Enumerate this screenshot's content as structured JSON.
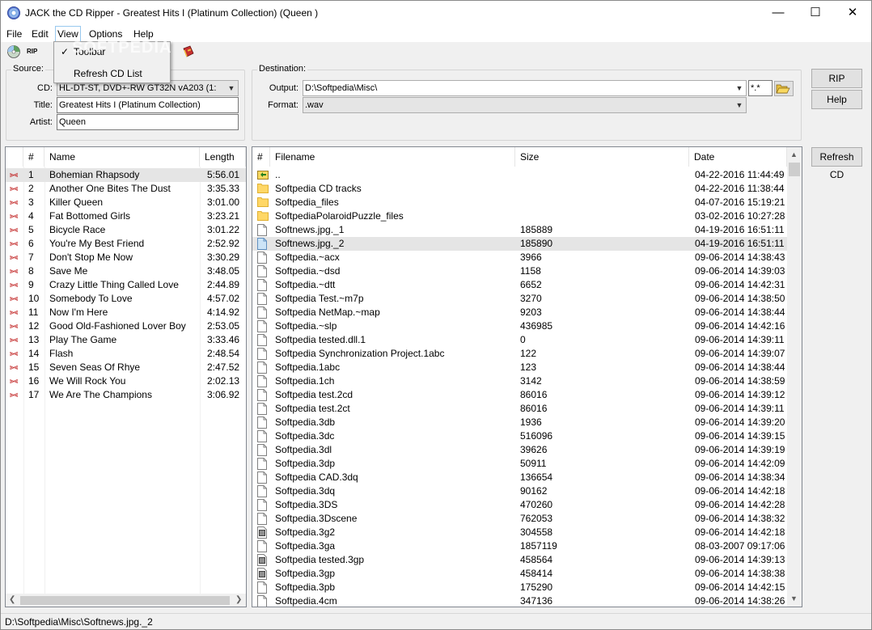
{
  "window": {
    "title": "JACK the CD Ripper - Greatest Hits I (Platinum  Collection) (Queen )",
    "controls": {
      "minimize": "—",
      "maximize": "☐",
      "close": "✕"
    }
  },
  "menu": [
    "File",
    "Edit",
    "View",
    "Options",
    "Help"
  ],
  "view_menu": {
    "items": [
      {
        "label": "Toolbar",
        "checked": true
      },
      {
        "label": "Refresh CD List",
        "checked": false
      }
    ]
  },
  "toolbar": {
    "rip_label": "RIP",
    "icons": [
      "cd-icon",
      "rip-icon",
      "book-icon"
    ]
  },
  "source": {
    "group_label": "Source:",
    "cd_label": "CD:",
    "cd_value": "HL-DT-ST, DVD+-RW GT32N    vA203 (1:",
    "title_label": "Title:",
    "title_value": "Greatest Hits I (Platinum  Collection)",
    "artist_label": "Artist:",
    "artist_value": "Queen"
  },
  "destination": {
    "group_label": "Destination:",
    "output_label": "Output:",
    "output_value": "D:\\Softpedia\\Misc\\",
    "mask_value": "*.*",
    "format_label": "Format:",
    "format_value": ".wav"
  },
  "buttons": {
    "rip": "RIP",
    "help": "Help",
    "refresh_cd": "Refresh CD"
  },
  "tracks": {
    "headers": [
      "#",
      "Name",
      "Length"
    ],
    "rows": [
      {
        "num": "1",
        "name": "Bohemian Rhapsody",
        "length": "5:56.01"
      },
      {
        "num": "2",
        "name": "Another One Bites The Dust",
        "length": "3:35.33"
      },
      {
        "num": "3",
        "name": "Killer Queen",
        "length": "3:01.00"
      },
      {
        "num": "4",
        "name": "Fat Bottomed Girls",
        "length": "3:23.21"
      },
      {
        "num": "5",
        "name": "Bicycle Race",
        "length": "3:01.22"
      },
      {
        "num": "6",
        "name": "You're My Best Friend",
        "length": "2:52.92"
      },
      {
        "num": "7",
        "name": "Don't Stop Me Now",
        "length": "3:30.29"
      },
      {
        "num": "8",
        "name": "Save Me",
        "length": "3:48.05"
      },
      {
        "num": "9",
        "name": "Crazy Little Thing Called Love",
        "length": "2:44.89"
      },
      {
        "num": "10",
        "name": "Somebody To Love",
        "length": "4:57.02"
      },
      {
        "num": "11",
        "name": "Now I'm Here",
        "length": "4:14.92"
      },
      {
        "num": "12",
        "name": "Good Old-Fashioned Lover Boy",
        "length": "2:53.05"
      },
      {
        "num": "13",
        "name": "Play The Game",
        "length": "3:33.46"
      },
      {
        "num": "14",
        "name": "Flash",
        "length": "2:48.54"
      },
      {
        "num": "15",
        "name": "Seven Seas Of Rhye",
        "length": "2:47.52"
      },
      {
        "num": "16",
        "name": "We Will Rock You",
        "length": "2:02.13"
      },
      {
        "num": "17",
        "name": "We Are The Champions",
        "length": "3:06.92"
      }
    ]
  },
  "files": {
    "headers": [
      "#",
      "Filename",
      "Size",
      "Date"
    ],
    "rows": [
      {
        "icon": "up-folder",
        "name": "..",
        "size": "",
        "date": "04-22-2016 11:44:49"
      },
      {
        "icon": "folder",
        "name": "Softpedia CD tracks",
        "size": "",
        "date": "04-22-2016 11:38:44"
      },
      {
        "icon": "folder",
        "name": "Softpedia_files",
        "size": "",
        "date": "04-07-2016 15:19:21"
      },
      {
        "icon": "folder",
        "name": "SoftpediaPolaroidPuzzle_files",
        "size": "",
        "date": "03-02-2016 10:27:28"
      },
      {
        "icon": "file",
        "name": "Softnews.jpg._1",
        "size": "185889",
        "date": "04-19-2016 16:51:11"
      },
      {
        "icon": "file-sel",
        "name": "Softnews.jpg._2",
        "size": "185890",
        "date": "04-19-2016 16:51:11"
      },
      {
        "icon": "file",
        "name": "Softpedia.~acx",
        "size": "3966",
        "date": "09-06-2014 14:38:43"
      },
      {
        "icon": "file",
        "name": "Softpedia.~dsd",
        "size": "1158",
        "date": "09-06-2014 14:39:03"
      },
      {
        "icon": "file",
        "name": "Softpedia.~dtt",
        "size": "6652",
        "date": "09-06-2014 14:42:31"
      },
      {
        "icon": "file",
        "name": "Softpedia Test.~m7p",
        "size": "3270",
        "date": "09-06-2014 14:38:50"
      },
      {
        "icon": "file",
        "name": "Softpedia NetMap.~map",
        "size": "9203",
        "date": "09-06-2014 14:38:44"
      },
      {
        "icon": "file",
        "name": "Softpedia.~slp",
        "size": "436985",
        "date": "09-06-2014 14:42:16"
      },
      {
        "icon": "file",
        "name": "Softpedia tested.dll.1",
        "size": "0",
        "date": "09-06-2014 14:39:11"
      },
      {
        "icon": "file",
        "name": "Softpedia Synchronization Project.1abc",
        "size": "122",
        "date": "09-06-2014 14:39:07"
      },
      {
        "icon": "file",
        "name": "Softpedia.1abc",
        "size": "123",
        "date": "09-06-2014 14:38:44"
      },
      {
        "icon": "file",
        "name": "Softpedia.1ch",
        "size": "3142",
        "date": "09-06-2014 14:38:59"
      },
      {
        "icon": "file",
        "name": "Softpedia test.2cd",
        "size": "86016",
        "date": "09-06-2014 14:39:12"
      },
      {
        "icon": "file",
        "name": "Softpedia test.2ct",
        "size": "86016",
        "date": "09-06-2014 14:39:11"
      },
      {
        "icon": "file",
        "name": "Softpedia.3db",
        "size": "1936",
        "date": "09-06-2014 14:39:20"
      },
      {
        "icon": "file",
        "name": "Softpedia.3dc",
        "size": "516096",
        "date": "09-06-2014 14:39:15"
      },
      {
        "icon": "file",
        "name": "Softpedia.3dl",
        "size": "39626",
        "date": "09-06-2014 14:39:19"
      },
      {
        "icon": "file",
        "name": "Softpedia.3dp",
        "size": "50911",
        "date": "09-06-2014 14:42:09"
      },
      {
        "icon": "file",
        "name": "Softpedia CAD.3dq",
        "size": "136654",
        "date": "09-06-2014 14:38:34"
      },
      {
        "icon": "file",
        "name": "Softpedia.3dq",
        "size": "90162",
        "date": "09-06-2014 14:42:18"
      },
      {
        "icon": "file",
        "name": "Softpedia.3DS",
        "size": "470260",
        "date": "09-06-2014 14:42:28"
      },
      {
        "icon": "file",
        "name": "Softpedia.3Dscene",
        "size": "762053",
        "date": "09-06-2014 14:38:32"
      },
      {
        "icon": "video",
        "name": "Softpedia.3g2",
        "size": "304558",
        "date": "09-06-2014 14:42:18"
      },
      {
        "icon": "file",
        "name": "Softpedia.3ga",
        "size": "1857119",
        "date": "08-03-2007 09:17:06"
      },
      {
        "icon": "video",
        "name": "Softpedia tested.3gp",
        "size": "458564",
        "date": "09-06-2014 14:39:13"
      },
      {
        "icon": "video",
        "name": "Softpedia.3gp",
        "size": "458414",
        "date": "09-06-2014 14:38:38"
      },
      {
        "icon": "file",
        "name": "Softpedia.3pb",
        "size": "175290",
        "date": "09-06-2014 14:42:15"
      },
      {
        "icon": "file",
        "name": "Softpedia.4cm",
        "size": "347136",
        "date": "09-06-2014 14:38:26"
      }
    ]
  },
  "status": "D:\\Softpedia\\Misc\\Softnews.jpg._2",
  "watermark": "SOFTPEDIA",
  "colors": {
    "selected_row": "#e5e5e5",
    "folder": "#ffd766",
    "menu_highlight": "#99c9ef"
  }
}
